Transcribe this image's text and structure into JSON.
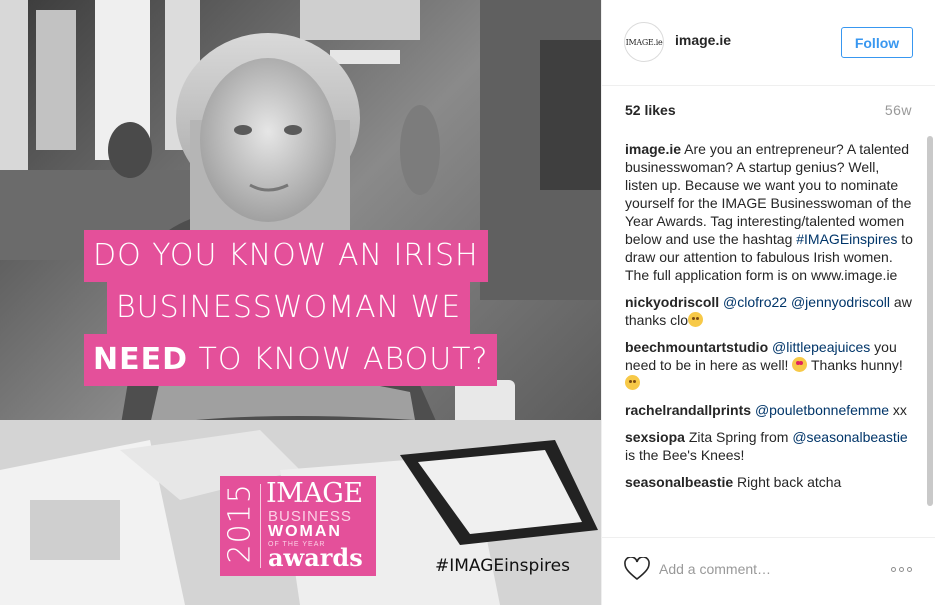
{
  "post_image": {
    "banner_lines": [
      "DO YOU KNOW AN IRISH",
      "BUSINESSWOMAN WE"
    ],
    "banner_line3_strong": "NEED",
    "banner_line3_rest": " TO KNOW ABOUT?",
    "award_logo": {
      "year": "2015",
      "brand": "IMAGE",
      "line1": "BUSINESS",
      "line2": "WOMAN",
      "line3": "OF THE YEAR",
      "line4": "awards"
    },
    "hashtag": "#IMAGEinspires"
  },
  "header": {
    "avatar_text": "IMAGE.ie",
    "username": "image.ie",
    "follow_label": "Follow"
  },
  "stats": {
    "likes": "52 likes",
    "time_ago": "56w"
  },
  "caption": {
    "user": "image.ie",
    "text_before_hashtag": " Are you an entrepreneur? A talented businesswoman? A startup genius? Well, listen up. Because we want you to nominate yourself for the IMAGE Businesswoman of the Year Awards. Tag interesting/talented women below and use the hashtag ",
    "hashtag": "#IMAGEinspires",
    "text_after_hashtag": " to draw our attention to fabulous Irish women. The full application form is on www.image.ie"
  },
  "comments": [
    {
      "user": "nickyodriscoll",
      "mentions": [
        "@clofro22",
        "@jennyodriscoll"
      ],
      "text": "aw thanks clo",
      "emoji": "kissing-face-icon"
    },
    {
      "user": "beechmountartstudio",
      "mention": "@littlepeajuices",
      "text": "you need to be in here as well!",
      "emoji1": "heart-eyes-icon",
      "text2": "Thanks hunny!",
      "emoji2": "kissing-closed-eyes-icon"
    },
    {
      "user": "rachelrandallprints",
      "mention": "@pouletbonnefemme",
      "text": "xx"
    },
    {
      "user": "sexsiopa",
      "text_before": " Zita Spring from",
      "mention": "@seasonalbeastie",
      "text_after": " is the Bee's Knees!"
    },
    {
      "user": "seasonalbeastie",
      "text": " Right back atcha"
    }
  ],
  "footer": {
    "comment_placeholder": "Add a comment…",
    "icons": [
      "heart-icon",
      "more-options-icon"
    ]
  },
  "colors": {
    "accent": "#3897f0",
    "banner_pink": "#e4509a",
    "mention": "#003569",
    "muted": "#999999"
  }
}
